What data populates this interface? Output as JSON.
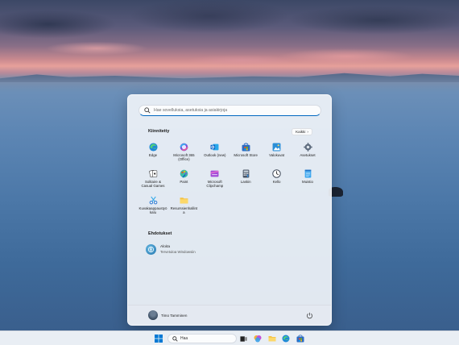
{
  "search": {
    "placeholder": "Hae sovelluksia, asetuksia ja asiakirjoja"
  },
  "pinned": {
    "title": "Kiinnitetty",
    "all_label": "Kaikki",
    "apps": [
      {
        "label": "Edge",
        "icon": "edge-icon"
      },
      {
        "label": "Microsoft 365\n(Office)",
        "icon": "microsoft-365-icon"
      },
      {
        "label": "Outlook (new)",
        "icon": "outlook-icon"
      },
      {
        "label": "Microsoft Store",
        "icon": "store-icon"
      },
      {
        "label": "Valokuvat",
        "icon": "photos-icon"
      },
      {
        "label": "Asetukset",
        "icon": "settings-icon"
      },
      {
        "label": "Solitaire &\nCasual Games",
        "icon": "solitaire-icon"
      },
      {
        "label": "Paint",
        "icon": "paint-icon"
      },
      {
        "label": "Microsoft\nClipchamp",
        "icon": "clipchamp-icon"
      },
      {
        "label": "Laskin",
        "icon": "calculator-icon"
      },
      {
        "label": "Kello",
        "icon": "clock-icon"
      },
      {
        "label": "Muistio",
        "icon": "notepad-icon"
      },
      {
        "label": "Kuvakaappaustyö\nkalu",
        "icon": "snipping-tool-icon"
      },
      {
        "label": "Resurssienhallint\na",
        "icon": "file-explorer-icon"
      }
    ]
  },
  "recommended": {
    "title": "Ehdotukset",
    "items": [
      {
        "title": "Aloita",
        "subtitle": "Tervetuloa Windowsiin"
      }
    ]
  },
  "user": {
    "name": "Timo Tamminen"
  },
  "taskbar": {
    "search_label": "Haa"
  },
  "colors": {
    "accent": "#0067c0",
    "menu_bg": "#eef2f8",
    "taskbar_bg": "#e9eef4"
  }
}
